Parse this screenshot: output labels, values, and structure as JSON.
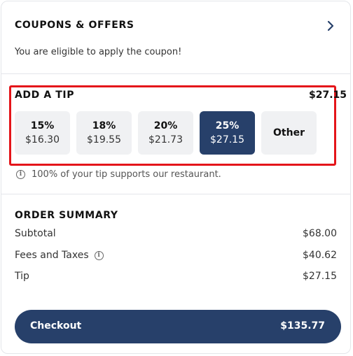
{
  "coupons": {
    "title": "COUPONS & OFFERS",
    "eligible_text": "You are eligible to apply the coupon!"
  },
  "tip": {
    "title": "ADD A TIP",
    "total": "$27.15",
    "options": [
      {
        "percent": "15%",
        "amount": "$16.30"
      },
      {
        "percent": "18%",
        "amount": "$19.55"
      },
      {
        "percent": "20%",
        "amount": "$21.73"
      },
      {
        "percent": "25%",
        "amount": "$27.15",
        "selected": true
      },
      {
        "percent": "Other"
      }
    ],
    "note": "100% of your tip supports our restaurant."
  },
  "summary": {
    "title": "ORDER SUMMARY",
    "rows": [
      {
        "label": "Subtotal",
        "value": "$68.00"
      },
      {
        "label": "Fees and Taxes",
        "value": "$40.62"
      },
      {
        "label": "Tip",
        "value": "$27.15"
      }
    ]
  },
  "checkout": {
    "label": "Checkout",
    "total": "$135.77"
  },
  "colors": {
    "accent": "#27406a",
    "highlight_outline": "#e4151a",
    "chip_bg": "#f0f1f3"
  }
}
